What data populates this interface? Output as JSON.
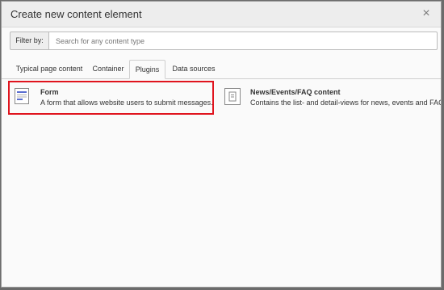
{
  "modal": {
    "title": "Create new content element",
    "close_label": "×"
  },
  "filter": {
    "label": "Filter by:",
    "placeholder": "Search for any content type",
    "value": ""
  },
  "tabs": [
    {
      "label": "Typical page content",
      "active": false
    },
    {
      "label": "Container",
      "active": false
    },
    {
      "label": "Plugins",
      "active": true
    },
    {
      "label": "Data sources",
      "active": false
    }
  ],
  "items": [
    {
      "icon": "form-icon",
      "title": "Form",
      "description": "A form that allows website users to submit messages.",
      "highlighted": true
    },
    {
      "icon": "news-icon",
      "title": "News/Events/FAQ content",
      "description": "Contains the list- and detail-views for news, events and FAQ",
      "highlighted": false
    }
  ],
  "colors": {
    "highlight_border": "#e0141e",
    "form_icon_accent": "#5a6ed0",
    "form_icon_line": "#b0b0b0"
  }
}
